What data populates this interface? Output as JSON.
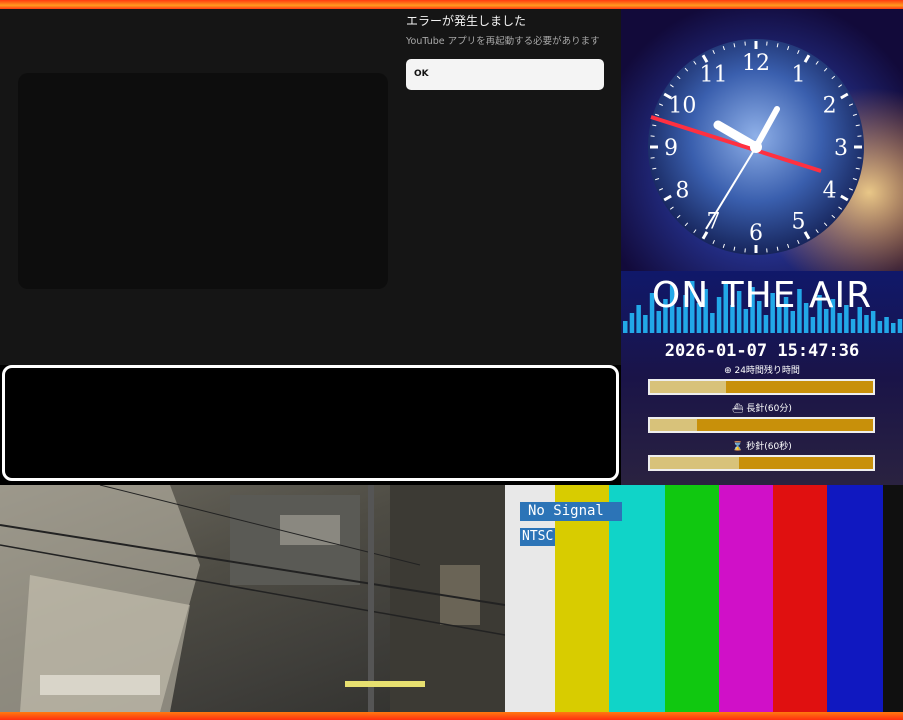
{
  "youtube_error": {
    "title": "エラーが発生しました",
    "message": "YouTube アプリを再起動する必要があります",
    "ok_label": "OK"
  },
  "clock": {
    "numerals": [
      "12",
      "1",
      "2",
      "3",
      "4",
      "5",
      "6",
      "7",
      "8",
      "9",
      "10",
      "11"
    ]
  },
  "onair": {
    "banner": "ON THE AIR",
    "datetime": "2026-01-07 15:47:36",
    "meters": [
      {
        "icon": "globe-icon",
        "label": "24時間残り時間",
        "fill": 0.34
      },
      {
        "icon": "ship-icon",
        "label": "長針(60分)",
        "fill": 0.21
      },
      {
        "icon": "hourglass-icon",
        "label": "秒針(60秒)",
        "fill": 0.4
      }
    ]
  },
  "signal": {
    "no_signal": "No Signal",
    "standard": "NTSC",
    "bar_colors": [
      "#e8e8e8",
      "#d8cc00",
      "#10d4c8",
      "#10c810",
      "#d010c8",
      "#e01010",
      "#1018c0",
      "#101010"
    ]
  }
}
